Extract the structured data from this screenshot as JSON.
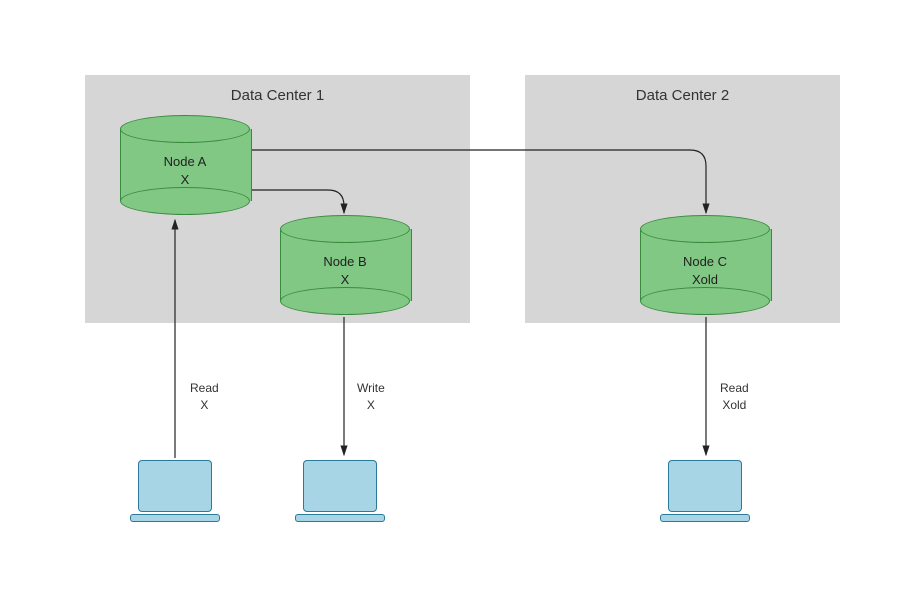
{
  "datacenters": {
    "dc1": {
      "title": "Data Center 1"
    },
    "dc2": {
      "title": "Data Center 2"
    }
  },
  "nodes": {
    "a": {
      "name": "Node A",
      "value": "X"
    },
    "b": {
      "name": "Node B",
      "value": "X"
    },
    "c": {
      "name": "Node C",
      "value": "Xold"
    }
  },
  "edges": {
    "read_a": {
      "op": "Read",
      "value": "X"
    },
    "write_b": {
      "op": "Write",
      "value": "X"
    },
    "read_c": {
      "op": "Read",
      "value": "Xold"
    }
  }
}
